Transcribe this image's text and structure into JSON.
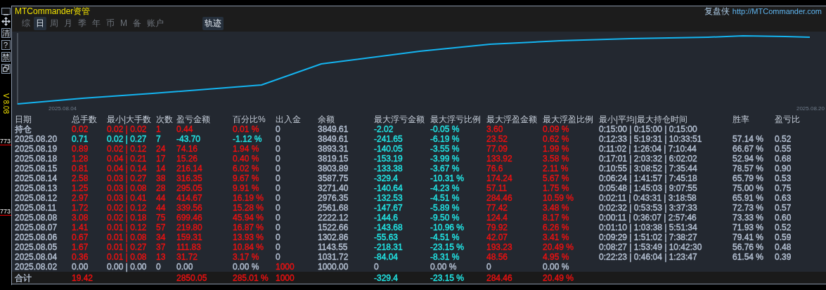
{
  "side_bar": {
    "buttons": [
      "清",
      "?",
      "禁"
    ],
    "version": "V 8.08",
    "price_labels": [
      "773",
      "773"
    ]
  },
  "title": "MTCommander资管",
  "brand": {
    "name": "复盘侠",
    "link": "http://MTCommander.com"
  },
  "tabs": [
    {
      "label": "综",
      "selected": false
    },
    {
      "label": "日",
      "selected": true
    },
    {
      "label": "周",
      "selected": false
    },
    {
      "label": "月",
      "selected": false
    },
    {
      "label": "季",
      "selected": false
    },
    {
      "label": "年",
      "selected": false
    },
    {
      "label": "币",
      "selected": false
    },
    {
      "label": "M",
      "selected": false
    },
    {
      "label": "备",
      "selected": false
    },
    {
      "label": "账户",
      "selected": false
    }
  ],
  "view_tabs": [
    {
      "label": "轨迹",
      "selected": true
    }
  ],
  "chart": {
    "x_start_label": "2025.08.04",
    "x_end_label": "2025.08.20"
  },
  "table": {
    "columns": [
      "日期",
      "总手数",
      "最小|大手数",
      "次数",
      "盈亏金额",
      "百分比%",
      "出入金",
      "余额",
      "最大浮亏金额",
      "最大浮亏比例",
      "最大浮盈金额",
      "最大浮盈比例",
      "最小|平均|最大持仓时间",
      "胜率",
      "盈亏比"
    ],
    "rows": [
      {
        "cells": [
          {
            "text": "持仓",
            "color": "#b6c2d4"
          },
          {
            "text": "0.02",
            "color": "#ee1111"
          },
          {
            "text": "0.02 | 0.02",
            "color": "#ee1111"
          },
          {
            "text": "1",
            "color": "#ee1111"
          },
          {
            "text": "0.44",
            "color": "#ee1111"
          },
          {
            "text": "0.01 %",
            "color": "#ee1111"
          },
          {
            "text": "0",
            "color": "#b6c2d4"
          },
          {
            "text": "3849.61",
            "color": "#b6c2d4"
          },
          {
            "text": "-2.02",
            "color": "#22e6e6"
          },
          {
            "text": "-0.05 %",
            "color": "#22e6e6"
          },
          {
            "text": "3.60",
            "color": "#ee1111"
          },
          {
            "text": "0.09 %",
            "color": "#ee1111"
          },
          {
            "text": "0:15:00 | 0:15:00 | 0:15:00",
            "color": "#b6c2d4"
          },
          null,
          null
        ]
      },
      {
        "cells": [
          {
            "text": "2025.08.20",
            "color": "#b6c2d4"
          },
          {
            "text": "0.71",
            "color": "#22e6e6"
          },
          {
            "text": "0.02 | 0.27",
            "color": "#22e6e6"
          },
          {
            "text": "7",
            "color": "#22e6e6"
          },
          {
            "text": "-43.70",
            "color": "#22e6e6"
          },
          {
            "text": "-1.12 %",
            "color": "#22e6e6"
          },
          {
            "text": "0",
            "color": "#b6c2d4"
          },
          {
            "text": "3849.61",
            "color": "#b6c2d4"
          },
          {
            "text": "-241.65",
            "color": "#22e6e6"
          },
          {
            "text": "-6.19 %",
            "color": "#22e6e6"
          },
          {
            "text": "23.52",
            "color": "#ee1111"
          },
          {
            "text": "0.62 %",
            "color": "#ee1111"
          },
          {
            "text": "0:12:33 | 5:19:31 | 10:33:51",
            "color": "#b6c2d4"
          },
          {
            "text": "57.14 %",
            "color": "#b6c2d4"
          },
          {
            "text": "0.52",
            "color": "#b6c2d4"
          }
        ]
      },
      {
        "cells": [
          {
            "text": "2025.08.19",
            "color": "#b6c2d4"
          },
          {
            "text": "0.89",
            "color": "#ee1111"
          },
          {
            "text": "0.02 | 0.12",
            "color": "#ee1111"
          },
          {
            "text": "24",
            "color": "#ee1111"
          },
          {
            "text": "74.16",
            "color": "#ee1111"
          },
          {
            "text": "1.94 %",
            "color": "#ee1111"
          },
          {
            "text": "0",
            "color": "#b6c2d4"
          },
          {
            "text": "3893.31",
            "color": "#b6c2d4"
          },
          {
            "text": "-140.05",
            "color": "#22e6e6"
          },
          {
            "text": "-3.55 %",
            "color": "#22e6e6"
          },
          {
            "text": "77.09",
            "color": "#ee1111"
          },
          {
            "text": "1.99 %",
            "color": "#ee1111"
          },
          {
            "text": "0:11:02 | 1:26:04 | 7:10:44",
            "color": "#b6c2d4"
          },
          {
            "text": "66.67 %",
            "color": "#b6c2d4"
          },
          {
            "text": "0.55",
            "color": "#b6c2d4"
          }
        ]
      },
      {
        "cells": [
          {
            "text": "2025.08.18",
            "color": "#b6c2d4"
          },
          {
            "text": "1.28",
            "color": "#ee1111"
          },
          {
            "text": "0.04 | 0.21",
            "color": "#ee1111"
          },
          {
            "text": "17",
            "color": "#ee1111"
          },
          {
            "text": "15.26",
            "color": "#ee1111"
          },
          {
            "text": "0.40 %",
            "color": "#ee1111"
          },
          {
            "text": "0",
            "color": "#b6c2d4"
          },
          {
            "text": "3819.15",
            "color": "#b6c2d4"
          },
          {
            "text": "-153.19",
            "color": "#22e6e6"
          },
          {
            "text": "-3.99 %",
            "color": "#22e6e6"
          },
          {
            "text": "133.92",
            "color": "#ee1111"
          },
          {
            "text": "3.58 %",
            "color": "#ee1111"
          },
          {
            "text": "0:17:01 | 2:03:32 | 6:02:02",
            "color": "#b6c2d4"
          },
          {
            "text": "52.94 %",
            "color": "#b6c2d4"
          },
          {
            "text": "0.68",
            "color": "#b6c2d4"
          }
        ]
      },
      {
        "cells": [
          {
            "text": "2025.08.15",
            "color": "#b6c2d4"
          },
          {
            "text": "0.81",
            "color": "#ee1111"
          },
          {
            "text": "0.04 | 0.14",
            "color": "#ee1111"
          },
          {
            "text": "14",
            "color": "#ee1111"
          },
          {
            "text": "216.14",
            "color": "#ee1111"
          },
          {
            "text": "6.02 %",
            "color": "#ee1111"
          },
          {
            "text": "0",
            "color": "#b6c2d4"
          },
          {
            "text": "3803.89",
            "color": "#b6c2d4"
          },
          {
            "text": "-133.38",
            "color": "#22e6e6"
          },
          {
            "text": "-3.67 %",
            "color": "#22e6e6"
          },
          {
            "text": "76.6",
            "color": "#ee1111"
          },
          {
            "text": "2.11 %",
            "color": "#ee1111"
          },
          {
            "text": "0:10:55 | 3:08:52 | 7:35:44",
            "color": "#b6c2d4"
          },
          {
            "text": "78.57 %",
            "color": "#b6c2d4"
          },
          {
            "text": "0.90",
            "color": "#b6c2d4"
          }
        ]
      },
      {
        "cells": [
          {
            "text": "2025.08.14",
            "color": "#b6c2d4"
          },
          {
            "text": "2.58",
            "color": "#ee1111"
          },
          {
            "text": "0.03 | 0.27",
            "color": "#ee1111"
          },
          {
            "text": "38",
            "color": "#ee1111"
          },
          {
            "text": "316.35",
            "color": "#ee1111"
          },
          {
            "text": "9.67 %",
            "color": "#ee1111"
          },
          {
            "text": "0",
            "color": "#b6c2d4"
          },
          {
            "text": "3587.75",
            "color": "#b6c2d4"
          },
          {
            "text": "-329.4",
            "color": "#22e6e6"
          },
          {
            "text": "-10.31 %",
            "color": "#22e6e6"
          },
          {
            "text": "174.24",
            "color": "#ee1111"
          },
          {
            "text": "5.67 %",
            "color": "#ee1111"
          },
          {
            "text": "0:06:24 | 1:41:57 | 7:45:18",
            "color": "#b6c2d4"
          },
          {
            "text": "65.79 %",
            "color": "#b6c2d4"
          },
          {
            "text": "0.53",
            "color": "#b6c2d4"
          }
        ]
      },
      {
        "cells": [
          {
            "text": "2025.08.13",
            "color": "#b6c2d4"
          },
          {
            "text": "1.25",
            "color": "#ee1111"
          },
          {
            "text": "0.03 | 0.08",
            "color": "#ee1111"
          },
          {
            "text": "28",
            "color": "#ee1111"
          },
          {
            "text": "295.05",
            "color": "#ee1111"
          },
          {
            "text": "9.91 %",
            "color": "#ee1111"
          },
          {
            "text": "0",
            "color": "#b6c2d4"
          },
          {
            "text": "3271.40",
            "color": "#b6c2d4"
          },
          {
            "text": "-140.64",
            "color": "#22e6e6"
          },
          {
            "text": "-4.23 %",
            "color": "#22e6e6"
          },
          {
            "text": "57.11",
            "color": "#ee1111"
          },
          {
            "text": "1.75 %",
            "color": "#ee1111"
          },
          {
            "text": "0:05:48 | 1:45:03 | 9:07:55",
            "color": "#b6c2d4"
          },
          {
            "text": "75.00 %",
            "color": "#b6c2d4"
          },
          {
            "text": "0.75",
            "color": "#b6c2d4"
          }
        ]
      },
      {
        "cells": [
          {
            "text": "2025.08.12",
            "color": "#b6c2d4"
          },
          {
            "text": "2.97",
            "color": "#ee1111"
          },
          {
            "text": "0.03 | 0.41",
            "color": "#ee1111"
          },
          {
            "text": "44",
            "color": "#ee1111"
          },
          {
            "text": "414.67",
            "color": "#ee1111"
          },
          {
            "text": "16.19 %",
            "color": "#ee1111"
          },
          {
            "text": "0",
            "color": "#b6c2d4"
          },
          {
            "text": "2976.35",
            "color": "#b6c2d4"
          },
          {
            "text": "-132.53",
            "color": "#22e6e6"
          },
          {
            "text": "-4.51 %",
            "color": "#22e6e6"
          },
          {
            "text": "284.46",
            "color": "#ee1111"
          },
          {
            "text": "10.59 %",
            "color": "#ee1111"
          },
          {
            "text": "0:02:11 | 0:43:31 | 3:18:58",
            "color": "#b6c2d4"
          },
          {
            "text": "65.91 %",
            "color": "#b6c2d4"
          },
          {
            "text": "0.63",
            "color": "#b6c2d4"
          }
        ]
      },
      {
        "cells": [
          {
            "text": "2025.08.11",
            "color": "#b6c2d4"
          },
          {
            "text": "1.72",
            "color": "#ee1111"
          },
          {
            "text": "0.02 | 0.12",
            "color": "#ee1111"
          },
          {
            "text": "44",
            "color": "#ee1111"
          },
          {
            "text": "339.56",
            "color": "#ee1111"
          },
          {
            "text": "15.28 %",
            "color": "#ee1111"
          },
          {
            "text": "0",
            "color": "#b6c2d4"
          },
          {
            "text": "2561.68",
            "color": "#b6c2d4"
          },
          {
            "text": "-147.67",
            "color": "#22e6e6"
          },
          {
            "text": "-5.89 %",
            "color": "#22e6e6"
          },
          {
            "text": "77.42",
            "color": "#ee1111"
          },
          {
            "text": "3.48 %",
            "color": "#ee1111"
          },
          {
            "text": "0:02:32 | 0:53:53 | 3:37:33",
            "color": "#b6c2d4"
          },
          {
            "text": "72.73 %",
            "color": "#b6c2d4"
          },
          {
            "text": "0.57",
            "color": "#b6c2d4"
          }
        ]
      },
      {
        "cells": [
          {
            "text": "2025.08.08",
            "color": "#b6c2d4"
          },
          {
            "text": "3.08",
            "color": "#ee1111"
          },
          {
            "text": "0.02 | 0.18",
            "color": "#ee1111"
          },
          {
            "text": "75",
            "color": "#ee1111"
          },
          {
            "text": "699.46",
            "color": "#ee1111"
          },
          {
            "text": "45.94 %",
            "color": "#ee1111"
          },
          {
            "text": "0",
            "color": "#b6c2d4"
          },
          {
            "text": "2222.12",
            "color": "#b6c2d4"
          },
          {
            "text": "-144.6",
            "color": "#22e6e6"
          },
          {
            "text": "-9.50 %",
            "color": "#22e6e6"
          },
          {
            "text": "124.4",
            "color": "#ee1111"
          },
          {
            "text": "8.17 %",
            "color": "#ee1111"
          },
          {
            "text": "0:00:11 | 0:36:07 | 2:57:46",
            "color": "#b6c2d4"
          },
          {
            "text": "73.33 %",
            "color": "#b6c2d4"
          },
          {
            "text": "0.60",
            "color": "#b6c2d4"
          }
        ]
      },
      {
        "cells": [
          {
            "text": "2025.08.07",
            "color": "#b6c2d4"
          },
          {
            "text": "1.41",
            "color": "#ee1111"
          },
          {
            "text": "0.01 | 0.12",
            "color": "#ee1111"
          },
          {
            "text": "57",
            "color": "#ee1111"
          },
          {
            "text": "219.80",
            "color": "#ee1111"
          },
          {
            "text": "16.87 %",
            "color": "#ee1111"
          },
          {
            "text": "0",
            "color": "#b6c2d4"
          },
          {
            "text": "1522.66",
            "color": "#b6c2d4"
          },
          {
            "text": "-143.68",
            "color": "#22e6e6"
          },
          {
            "text": "-10.96 %",
            "color": "#22e6e6"
          },
          {
            "text": "79.92",
            "color": "#ee1111"
          },
          {
            "text": "6.26 %",
            "color": "#ee1111"
          },
          {
            "text": "0:01:10 | 1:03:38 | 5:51:34",
            "color": "#b6c2d4"
          },
          {
            "text": "71.93 %",
            "color": "#b6c2d4"
          },
          {
            "text": "0.52",
            "color": "#b6c2d4"
          }
        ]
      },
      {
        "cells": [
          {
            "text": "2025.08.06",
            "color": "#b6c2d4"
          },
          {
            "text": "0.67",
            "color": "#ee1111"
          },
          {
            "text": "0.01 | 0.08",
            "color": "#ee1111"
          },
          {
            "text": "34",
            "color": "#ee1111"
          },
          {
            "text": "159.31",
            "color": "#ee1111"
          },
          {
            "text": "13.93 %",
            "color": "#ee1111"
          },
          {
            "text": "0",
            "color": "#b6c2d4"
          },
          {
            "text": "1302.86",
            "color": "#b6c2d4"
          },
          {
            "text": "-55.63",
            "color": "#22e6e6"
          },
          {
            "text": "-4.51 %",
            "color": "#22e6e6"
          },
          {
            "text": "42.07",
            "color": "#ee1111"
          },
          {
            "text": "3.41 %",
            "color": "#ee1111"
          },
          {
            "text": "0:09:29 | 1:51:02 | 7:38:27",
            "color": "#b6c2d4"
          },
          {
            "text": "79.41 %",
            "color": "#b6c2d4"
          },
          {
            "text": "0.59",
            "color": "#b6c2d4"
          }
        ]
      },
      {
        "cells": [
          {
            "text": "2025.08.05",
            "color": "#b6c2d4"
          },
          {
            "text": "1.67",
            "color": "#ee1111"
          },
          {
            "text": "0.01 | 0.27",
            "color": "#ee1111"
          },
          {
            "text": "37",
            "color": "#ee1111"
          },
          {
            "text": "111.83",
            "color": "#ee1111"
          },
          {
            "text": "10.84 %",
            "color": "#ee1111"
          },
          {
            "text": "0",
            "color": "#b6c2d4"
          },
          {
            "text": "1143.55",
            "color": "#b6c2d4"
          },
          {
            "text": "-218.31",
            "color": "#22e6e6"
          },
          {
            "text": "-23.15 %",
            "color": "#22e6e6"
          },
          {
            "text": "193.23",
            "color": "#ee1111"
          },
          {
            "text": "20.49 %",
            "color": "#ee1111"
          },
          {
            "text": "0:08:27 | 1:53:49 | 10:42:30",
            "color": "#b6c2d4"
          },
          {
            "text": "56.76 %",
            "color": "#b6c2d4"
          },
          {
            "text": "0.48",
            "color": "#b6c2d4"
          }
        ]
      },
      {
        "cells": [
          {
            "text": "2025.08.04",
            "color": "#b6c2d4"
          },
          {
            "text": "0.36",
            "color": "#ee1111"
          },
          {
            "text": "0.01 | 0.08",
            "color": "#ee1111"
          },
          {
            "text": "13",
            "color": "#ee1111"
          },
          {
            "text": "31.72",
            "color": "#ee1111"
          },
          {
            "text": "3.17 %",
            "color": "#ee1111"
          },
          {
            "text": "0",
            "color": "#b6c2d4"
          },
          {
            "text": "1031.72",
            "color": "#b6c2d4"
          },
          {
            "text": "-84.04",
            "color": "#22e6e6"
          },
          {
            "text": "-8.31 %",
            "color": "#22e6e6"
          },
          {
            "text": "48.56",
            "color": "#ee1111"
          },
          {
            "text": "4.95 %",
            "color": "#ee1111"
          },
          {
            "text": "0:22:23 | 0:46:04 | 1:23:47",
            "color": "#b6c2d4"
          },
          {
            "text": "61.54 %",
            "color": "#b6c2d4"
          },
          {
            "text": "0.39",
            "color": "#b6c2d4"
          }
        ]
      },
      {
        "cells": [
          {
            "text": "2025.08.02",
            "color": "#b6c2d4"
          },
          {
            "text": "0.00",
            "color": "#b6c2d4"
          },
          {
            "text": "0.00 | 0.00",
            "color": "#b6c2d4"
          },
          {
            "text": "0",
            "color": "#b6c2d4"
          },
          {
            "text": "0.00",
            "color": "#b6c2d4"
          },
          {
            "text": "0.00 %",
            "color": "#b6c2d4"
          },
          {
            "text": "1000",
            "color": "#ee1111"
          },
          {
            "text": "1000.00",
            "color": "#b6c2d4"
          },
          {
            "text": "0",
            "color": "#b6c2d4"
          },
          {
            "text": "0.00 %",
            "color": "#b6c2d4"
          },
          {
            "text": "0",
            "color": "#b6c2d4"
          },
          {
            "text": "0.00 %",
            "color": "#b6c2d4"
          },
          null,
          null,
          null
        ]
      }
    ],
    "total": {
      "cells": [
        {
          "text": "合计",
          "color": "#b6c2d4"
        },
        {
          "text": "19.42",
          "color": "#ee1111"
        },
        null,
        null,
        {
          "text": "2850.05",
          "color": "#ee1111"
        },
        {
          "text": "285.01 %",
          "color": "#ee1111"
        },
        {
          "text": "1000",
          "color": "#ee1111"
        },
        null,
        {
          "text": "-329.4",
          "color": "#22e6e6"
        },
        {
          "text": "-23.15 %",
          "color": "#22e6e6"
        },
        {
          "text": "284.46",
          "color": "#ee1111"
        },
        {
          "text": "20.49 %",
          "color": "#ee1111"
        },
        null,
        null,
        null
      ]
    }
  }
}
